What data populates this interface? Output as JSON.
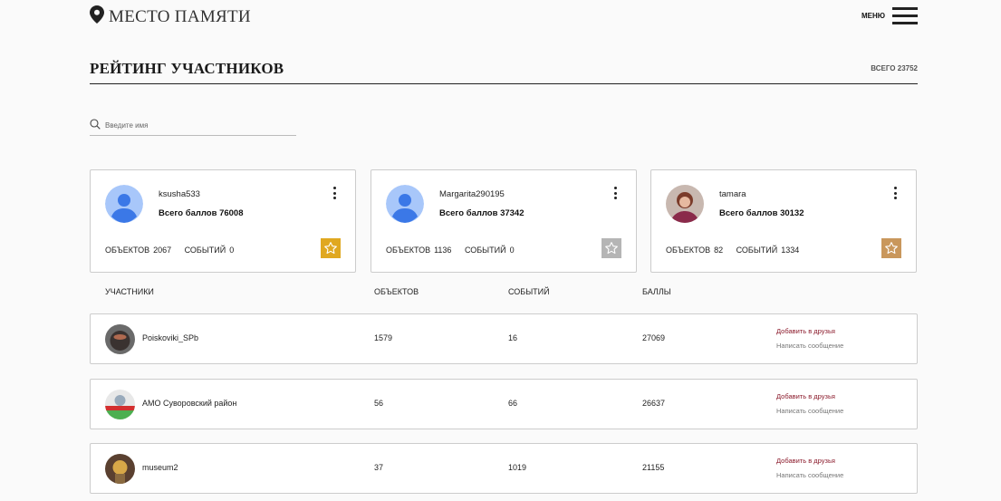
{
  "header": {
    "logo_text": "МЕСТО ПАМЯТИ",
    "menu_label": "МЕНЮ"
  },
  "page": {
    "title": "РЕЙТИНГ УЧАСТНИКОВ",
    "total": "ВСЕГО 23752"
  },
  "search": {
    "placeholder": "Введите имя"
  },
  "top_cards": [
    {
      "name": "ksusha533",
      "points": "Всего баллов 76008",
      "objects_label": "ОБЪЕКТОВ",
      "objects": "2067",
      "events_label": "СОБЫТИЙ",
      "events": "0",
      "star_color": "#e0a820",
      "avatar": "default-user-icon"
    },
    {
      "name": "Margarita290195",
      "points": "Всего баллов 37342",
      "objects_label": "ОБЪЕКТОВ",
      "objects": "1136",
      "events_label": "СОБЫТИЙ",
      "events": "0",
      "star_color": "#b5b5b5",
      "avatar": "default-user-icon"
    },
    {
      "name": "tamara",
      "points": "Всего баллов 30132",
      "objects_label": "ОБЪЕКТОВ",
      "objects": "82",
      "events_label": "СОБЫТИЙ",
      "events": "1334",
      "star_color": "#c9975c",
      "avatar": "user-photo"
    }
  ],
  "table": {
    "headers": [
      "УЧАСТНИКИ",
      "ОБЪЕКТОВ",
      "СОБЫТИЙ",
      "БАЛЛЫ"
    ],
    "rows": [
      {
        "name": "Poiskoviki_SPb",
        "objects": "1579",
        "events": "16",
        "points": "27069",
        "add_label": "Добавить в друзья",
        "msg_label": "Написать сообщение"
      },
      {
        "name": "АМО Суворовский район",
        "objects": "56",
        "events": "66",
        "points": "26637",
        "add_label": "Добавить в друзья",
        "msg_label": "Написать сообщение"
      },
      {
        "name": "museum2",
        "objects": "37",
        "events": "1019",
        "points": "21155",
        "add_label": "Добавить в друзья",
        "msg_label": "Написать сообщение"
      }
    ]
  },
  "colors": {
    "accent_link": "#8b1a2b",
    "default_avatar_bg": "#a8c7fa",
    "default_avatar_fg": "#3b78e7"
  }
}
